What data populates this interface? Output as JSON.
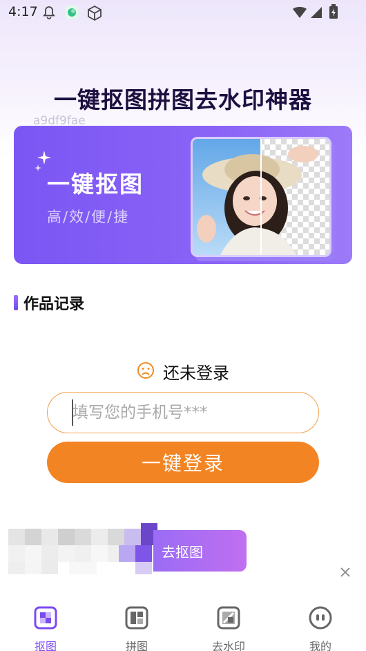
{
  "status_bar": {
    "time": "4:17",
    "icons": [
      "notification-bell-icon",
      "app-icon",
      "cube-icon",
      "wifi-icon",
      "signal-icon",
      "battery-charging-icon"
    ]
  },
  "app_title": "一键抠图拼图去水印神器",
  "watermark_id": "a9df9fae",
  "banner": {
    "title": "一键抠图",
    "subtitle": "高/效/便/捷",
    "accent": "#7b56f3"
  },
  "section": {
    "title": "作品记录"
  },
  "login": {
    "status_text": "还未登录",
    "phone_placeholder": "填写您的手机号***",
    "phone_value": "",
    "button_label": "一键登录",
    "button_color": "#f28423"
  },
  "ad": {
    "action_label": "去抠图",
    "close_icon": "close-icon"
  },
  "tabs": [
    {
      "label": "抠图",
      "icon": "cutout-icon",
      "active": true
    },
    {
      "label": "拼图",
      "icon": "collage-icon",
      "active": false
    },
    {
      "label": "去水印",
      "icon": "remove-watermark-icon",
      "active": false
    },
    {
      "label": "我的",
      "icon": "profile-icon",
      "active": false
    }
  ],
  "colors": {
    "active_tab": "#7c4bef",
    "inactive_tab": "#666666"
  }
}
